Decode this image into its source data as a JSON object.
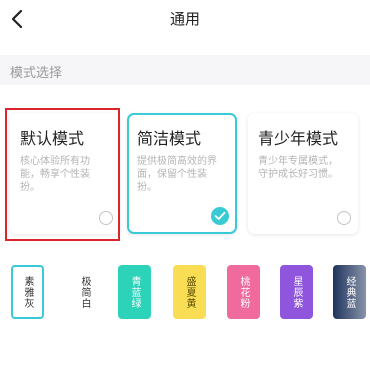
{
  "header": {
    "title": "通用"
  },
  "section": {
    "label": "模式选择"
  },
  "modes": [
    {
      "title": "默认模式",
      "desc": "核心体验所有功能，畅享个性装扮。",
      "selected": false
    },
    {
      "title": "简洁模式",
      "desc": "提供极简高效的界面，保留个性装扮。",
      "selected": true
    },
    {
      "title": "青少年模式",
      "desc": "青少年专属模式，守护成长好习惯。",
      "selected": false
    }
  ],
  "themes": [
    {
      "label": "素雅灰",
      "bg": "#ffffff",
      "fg": "#333333",
      "selected": true
    },
    {
      "label": "极简白",
      "bg": "#ffffff",
      "fg": "#333333",
      "selected": false
    },
    {
      "label": "青蓝绿",
      "bg": "#2dd3b9",
      "fg": "#ffffff",
      "selected": false
    },
    {
      "label": "盛夏黄",
      "bg": "#f9de55",
      "fg": "#5a4a00",
      "selected": false
    },
    {
      "label": "桃花粉",
      "bg": "#f06a9e",
      "fg": "#ffffff",
      "selected": false
    },
    {
      "label": "星辰紫",
      "bg": "#8f56dd",
      "fg": "#ffffff",
      "selected": false
    },
    {
      "label": "经典蓝",
      "bg": "#152b57",
      "fg": "#ffffff",
      "selected": false
    }
  ],
  "colors": {
    "accent": "#39cbd5",
    "highlight": "#d8262c"
  }
}
